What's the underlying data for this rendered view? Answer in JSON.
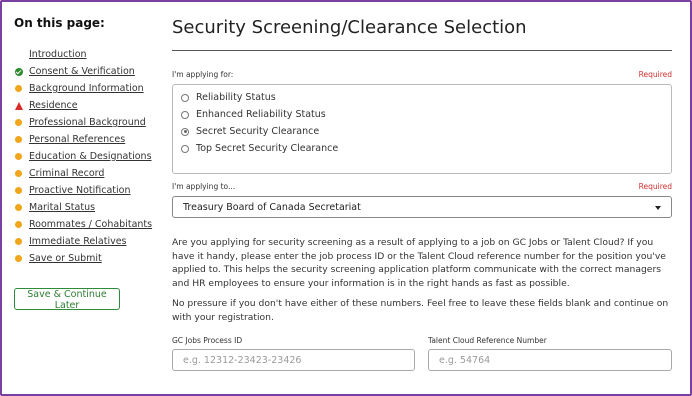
{
  "sidebar": {
    "heading": "On this page:",
    "items": [
      {
        "label": "Introduction",
        "status": "none"
      },
      {
        "label": "Consent & Verification",
        "status": "complete"
      },
      {
        "label": "Background Information",
        "status": "incomplete"
      },
      {
        "label": "Residence",
        "status": "error"
      },
      {
        "label": "Professional Background",
        "status": "incomplete"
      },
      {
        "label": "Personal References",
        "status": "incomplete"
      },
      {
        "label": "Education & Designations",
        "status": "incomplete"
      },
      {
        "label": "Criminal Record",
        "status": "incomplete"
      },
      {
        "label": "Proactive Notification",
        "status": "incomplete"
      },
      {
        "label": "Marital Status",
        "status": "incomplete"
      },
      {
        "label": "Roommates / Cohabitants",
        "status": "incomplete"
      },
      {
        "label": "Immediate Relatives",
        "status": "incomplete"
      },
      {
        "label": "Save or Submit",
        "status": "incomplete"
      }
    ],
    "save_button": "Save & Continue Later"
  },
  "main": {
    "title": "Security Screening/Clearance Selection",
    "applying_for": {
      "label": "I'm applying for:",
      "required": "Required",
      "options": [
        {
          "label": "Reliability Status",
          "selected": false
        },
        {
          "label": "Enhanced Reliability Status",
          "selected": false
        },
        {
          "label": "Secret Security Clearance",
          "selected": true
        },
        {
          "label": "Top Secret Security Clearance",
          "selected": false
        }
      ]
    },
    "applying_to": {
      "label": "I'm applying to...",
      "required": "Required",
      "value": "Treasury Board of Canada Secretariat"
    },
    "paragraph1": "Are you applying for security screening as a result of applying to a job on GC Jobs or Talent Cloud? If you have it handy, please enter the job process ID or the Talent Cloud reference number for the position you've applied to. This helps the security screening application platform communicate with the correct managers and HR employees to ensure your information is in the right hands as fast as possible.",
    "paragraph2": "No pressure if you don't have either of these numbers. Feel free to leave these fields blank and continue on with your registration.",
    "gc_jobs": {
      "label": "GC Jobs Process ID",
      "placeholder": "e.g. 12312-23423-23426",
      "value": ""
    },
    "talent_cloud": {
      "label": "Talent Cloud Reference Number",
      "placeholder": "e.g. 54764",
      "value": ""
    }
  },
  "colors": {
    "frame": "#7b3fa0",
    "complete": "#2d8a2d",
    "incomplete": "#f0a51a",
    "error": "#d92a2a",
    "required": "#d32f2f",
    "save_button": "#2e8b3a"
  }
}
